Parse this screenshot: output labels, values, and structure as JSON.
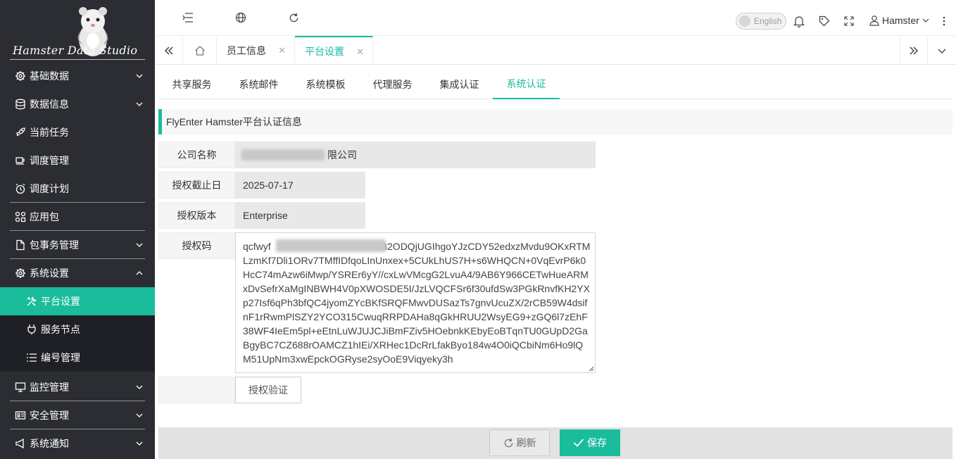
{
  "app": {
    "logo_text": "Hamster Data Studio",
    "accent_color": "#1abc9c",
    "sidebar_bg": "#2b2d33"
  },
  "sidebar": {
    "items": [
      {
        "label": "基础数据",
        "icon": "gear-icon",
        "expandable": true
      },
      {
        "label": "数据信息",
        "icon": "database-icon",
        "expandable": true
      },
      {
        "label": "当前任务",
        "icon": "rocket-icon",
        "expandable": false
      },
      {
        "label": "调度管理",
        "icon": "coffee-icon",
        "expandable": false
      },
      {
        "label": "调度计划",
        "icon": "alarm-clock-icon",
        "expandable": false
      },
      {
        "label": "应用包",
        "icon": "cluster-icon",
        "expandable": false
      },
      {
        "label": "包事务管理",
        "icon": "file-icon",
        "expandable": true
      },
      {
        "label": "系统设置",
        "icon": "gear-icon",
        "expandable": true,
        "expanded": true
      },
      {
        "label": "监控管理",
        "icon": "monitor-icon",
        "expandable": true
      },
      {
        "label": "安全管理",
        "icon": "id-card-icon",
        "expandable": true
      },
      {
        "label": "系统通知",
        "icon": "megaphone-icon",
        "expandable": true
      }
    ],
    "submenu": [
      {
        "label": "平台设置",
        "icon": "tools-icon",
        "active": true
      },
      {
        "label": "服务节点",
        "icon": "plug-icon",
        "active": false
      },
      {
        "label": "编号管理",
        "icon": "list-icon",
        "active": false
      }
    ]
  },
  "header": {
    "language": "English",
    "username": "Hamster"
  },
  "tabs": [
    {
      "label": "员工信息",
      "active": false
    },
    {
      "label": "平台设置",
      "active": true
    }
  ],
  "subtabs": [
    {
      "label": "共享服务",
      "active": false
    },
    {
      "label": "系统邮件",
      "active": false
    },
    {
      "label": "系统模板",
      "active": false
    },
    {
      "label": "代理服务",
      "active": false
    },
    {
      "label": "集成认证",
      "active": false
    },
    {
      "label": "系统认证",
      "active": true
    }
  ],
  "section": {
    "title": "FlyEnter Hamster平台认证信息"
  },
  "form": {
    "company_label": "公司名称",
    "company_value_visible": "限公司",
    "expiry_label": "授权截止日",
    "expiry_value": "2025-07-17",
    "version_label": "授权版本",
    "version_value": "Enterprise",
    "code_label": "授权码",
    "code_value_start": "qcfwyf",
    "code_value_line1_rest": "B2ODQjUGIhgoYJzCDY52edxzMvdu9OKxR",
    "code_value_rest": "TMLzmKf7Dli1ORv7TMffIDfqoLInUnxex+5CUkLhUS7H+s6WHQCN+0VqEvrP6k0HcC74mAzw6iMwp/YSREr6yY//cxLwVMcgG2LvuA4/9AB6Y966CETwHueARMxDvSefrXaMgINBWH4V0pXWOSDE5I/JzLVQCFSr6f30ufdSw3PGkRnvfKH2YXp27Isf6qPh3bfQC4jyomZYcBKfSRQFMwvDUSazTs7gnvUcuZX/2rCB59W4dsifnF1rRwmPlSZY2YCO315CwuqRRPDAHa8qGkHRUU2WsyEG9+zGQ6l7zEhF38WF4IeEm5pl+eEtnLuWJUJCJiBmFZiv5HOebnkKEbyEoBTqnTU0GUpD2GaBgyBC7CZ688rOAMCZ1hIEi/XRHec1DcRrLfakByo184w4O0iQCbiNm6Ho9lQM51UpNm3xwEpckOGRyse2syOoE9Viqyeky3h",
    "verify_button": "授权验证"
  },
  "footer": {
    "refresh_button": "刷新",
    "save_button": "保存"
  }
}
